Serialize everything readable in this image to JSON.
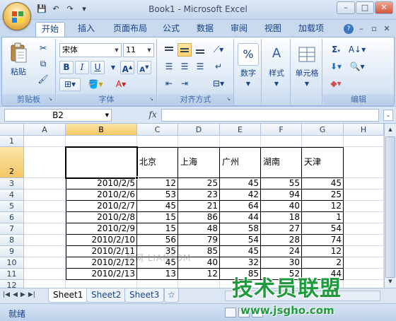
{
  "window": {
    "title": "Book1 - Microsoft Excel",
    "controls": {
      "minimize": "–",
      "maximize": "□",
      "close": "✕"
    }
  },
  "qat": {
    "save": "💾",
    "undo": "↶",
    "redo": "↷",
    "customize": "▾"
  },
  "ribbon_tabs": [
    "开始",
    "插入",
    "页面布局",
    "公式",
    "数据",
    "审阅",
    "视图",
    "加载项"
  ],
  "active_tab": "开始",
  "ribbon": {
    "clipboard": {
      "label": "剪贴板",
      "paste": "粘贴"
    },
    "font": {
      "label": "字体",
      "family": "宋体",
      "size": "11",
      "bold": "B",
      "italic": "I",
      "underline": "U",
      "grow": "A",
      "shrink": "A"
    },
    "alignment": {
      "label": "对齐方式"
    },
    "number": {
      "label": "数字"
    },
    "styles": {
      "label": "样式"
    },
    "cells": {
      "label": "单元格"
    },
    "editing": {
      "label": "编辑",
      "sum": "Σ"
    }
  },
  "formula_bar": {
    "name_box": "B2",
    "fx": "fx",
    "value": ""
  },
  "grid": {
    "columns": [
      "A",
      "B",
      "C",
      "D",
      "E",
      "F",
      "G",
      "H"
    ],
    "rows": [
      "1",
      "2",
      "3",
      "4",
      "5",
      "6",
      "7",
      "8",
      "9",
      "10",
      "11",
      "12",
      "13"
    ],
    "selected_cell": "B2",
    "table_header": [
      "",
      "北京",
      "上海",
      "广州",
      "湖南",
      "天津"
    ],
    "table_rows": [
      [
        "2010/2/5",
        "12",
        "25",
        "45",
        "55",
        "45"
      ],
      [
        "2010/2/6",
        "53",
        "23",
        "42",
        "94",
        "25"
      ],
      [
        "2010/2/7",
        "45",
        "21",
        "64",
        "40",
        "12"
      ],
      [
        "2010/2/8",
        "15",
        "86",
        "44",
        "18",
        "1"
      ],
      [
        "2010/2/9",
        "15",
        "48",
        "58",
        "27",
        "54"
      ],
      [
        "2010/2/10",
        "56",
        "79",
        "54",
        "28",
        "74"
      ],
      [
        "2010/2/11",
        "35",
        "85",
        "45",
        "24",
        "12"
      ],
      [
        "2010/2/12",
        "45",
        "40",
        "32",
        "30",
        "2"
      ],
      [
        "2010/2/13",
        "13",
        "12",
        "85",
        "52",
        "44"
      ]
    ]
  },
  "sheet_tabs": [
    "Sheet1",
    "Sheet2",
    "Sheet3"
  ],
  "active_sheet": "Sheet1",
  "status": {
    "ready": "就绪"
  },
  "watermark": {
    "brand": "技术员联盟",
    "url": "www.jsgho.com",
    "faint": "软网  LIANTOM"
  }
}
